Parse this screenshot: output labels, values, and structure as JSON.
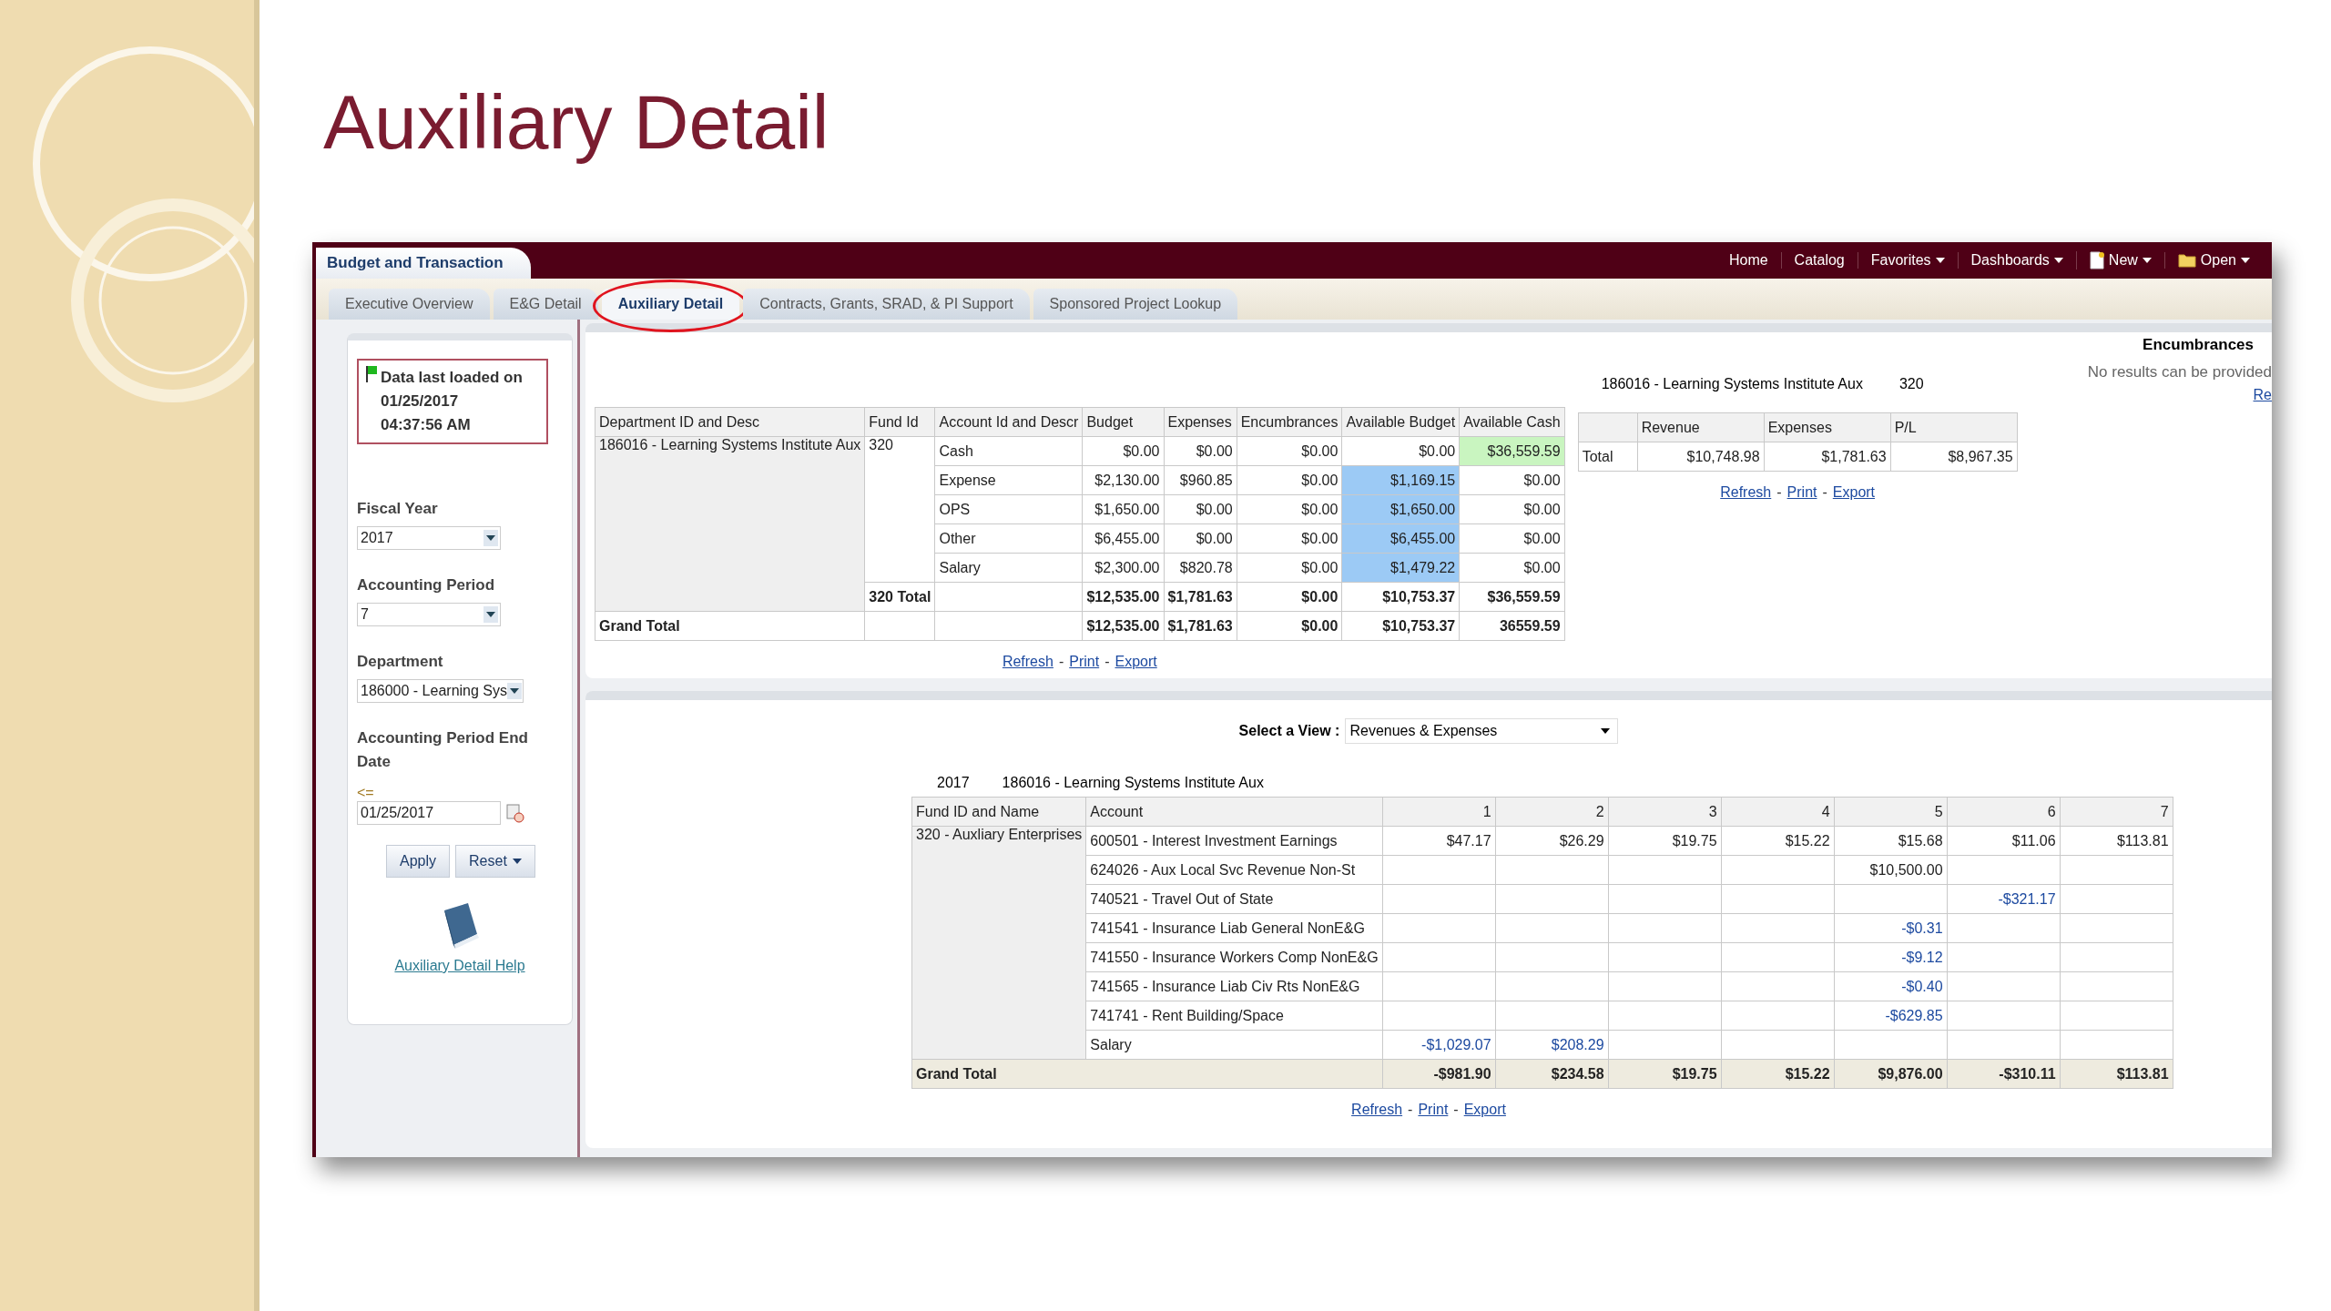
{
  "slide": {
    "title": "Auxiliary Detail"
  },
  "app": {
    "title": "Budget and Transaction",
    "nav": [
      {
        "label": "Home",
        "kind": "link"
      },
      {
        "label": "Catalog",
        "kind": "link"
      },
      {
        "label": "Favorites",
        "kind": "menu"
      },
      {
        "label": "Dashboards",
        "kind": "menu"
      },
      {
        "label": "New",
        "kind": "doc-menu"
      },
      {
        "label": "Open",
        "kind": "folder-menu"
      }
    ],
    "tabs": [
      {
        "label": "Executive Overview",
        "selected": false,
        "circled": false
      },
      {
        "label": "E&G Detail",
        "selected": false,
        "circled": false
      },
      {
        "label": "Auxiliary Detail",
        "selected": true,
        "circled": true
      },
      {
        "label": "Contracts, Grants, SRAD, & PI Support",
        "selected": false,
        "circled": false
      },
      {
        "label": "Sponsored Project Lookup",
        "selected": false,
        "circled": false
      }
    ],
    "sidebar": {
      "status": [
        "Data last loaded on",
        "01/25/2017",
        "04:37:56 AM"
      ],
      "filters": [
        {
          "label": "Fiscal Year",
          "value": "2017",
          "kind": "select"
        },
        {
          "label": "Accounting Period",
          "value": "7",
          "kind": "select"
        },
        {
          "label": "Department",
          "value": "186000 - Learning Sys",
          "kind": "select"
        },
        {
          "label": "Accounting Period End Date",
          "operator": "<=",
          "value": "01/25/2017",
          "kind": "date"
        }
      ],
      "buttons": [
        {
          "label": "Apply",
          "kind": "button"
        },
        {
          "label": "Reset",
          "kind": "menu"
        }
      ],
      "help_link": "Auxiliary Detail Help"
    },
    "summary": {
      "columns": [
        "Department ID and Desc",
        "Fund Id",
        "Account Id and Descr",
        "Budget",
        "Expenses",
        "Encumbrances",
        "Available Budget",
        "Available Cash"
      ],
      "department": "186016 - Learning Systems Institute Aux",
      "fund": "320",
      "rows": [
        {
          "account": "Cash",
          "values": [
            "$0.00",
            "$0.00",
            "$0.00",
            "$0.00",
            "$36,559.59"
          ],
          "kind": "cash"
        },
        {
          "account": "Expense",
          "values": [
            "$2,130.00",
            "$960.85",
            "$0.00",
            "$1,169.15",
            "$0.00"
          ],
          "kind": "budget"
        },
        {
          "account": "OPS",
          "values": [
            "$1,650.00",
            "$0.00",
            "$0.00",
            "$1,650.00",
            "$0.00"
          ],
          "kind": "budget"
        },
        {
          "account": "Other",
          "values": [
            "$6,455.00",
            "$0.00",
            "$0.00",
            "$6,455.00",
            "$0.00"
          ],
          "kind": "budget"
        },
        {
          "account": "Salary",
          "values": [
            "$2,300.00",
            "$820.78",
            "$0.00",
            "$1,479.22",
            "$0.00"
          ],
          "kind": "budget"
        }
      ],
      "subtotal": {
        "label": "320 Total",
        "values": [
          "$12,535.00",
          "$1,781.63",
          "$0.00",
          "$10,753.37",
          "$36,559.59"
        ]
      },
      "grand_total": {
        "label": "Grand Total",
        "values": [
          "$12,535.00",
          "$1,781.63",
          "$0.00",
          "$10,753.37",
          "36559.59"
        ]
      },
      "links": [
        "Refresh",
        "Print",
        "Export"
      ],
      "separator": "-"
    },
    "pl": {
      "department": "186016 - Learning Systems Institute Aux",
      "fund": "320",
      "columns": [
        "Revenue",
        "Expenses",
        "P/L"
      ],
      "row": {
        "label": "Total",
        "values": [
          "$10,748.98",
          "$1,781.63",
          "$8,967.35"
        ]
      },
      "links": [
        "Refresh",
        "Print",
        "Export"
      ],
      "separator": "-"
    },
    "encumbrances": {
      "title": "Encumbrances",
      "message": "No results can be provided",
      "link": "Re"
    },
    "detail": {
      "view_label": "Select a View :",
      "view": "Revenues & Expenses",
      "year": "2017",
      "department": "186016 - Learning Systems Institute Aux",
      "columns": [
        "Fund ID and Name",
        "Account",
        "1",
        "2",
        "3",
        "4",
        "5",
        "6",
        "7"
      ],
      "fund": "320 - Auxliary Enterprises",
      "rows": [
        {
          "account": "600501 - Interest Investment Earnings",
          "values": {
            "p1": "$47.17",
            "p2": "$26.29",
            "p3": "$19.75",
            "p4": "$15.22",
            "p5": "$15.68",
            "p6": "$11.06",
            "p7": "$113.81"
          },
          "link": false
        },
        {
          "account": "624026 - Aux Local Svc Revenue Non-St",
          "values": {
            "p5": "$10,500.00"
          },
          "link": false
        },
        {
          "account": "740521 - Travel Out of State",
          "values": {
            "p6": "-$321.17"
          },
          "link": true
        },
        {
          "account": "741541 - Insurance Liab General NonE&G",
          "values": {
            "p5": "-$0.31"
          },
          "link": true
        },
        {
          "account": "741550 - Insurance Workers Comp NonE&G",
          "values": {
            "p5": "-$9.12"
          },
          "link": true
        },
        {
          "account": "741565 - Insurance Liab Civ Rts NonE&G",
          "values": {
            "p5": "-$0.40"
          },
          "link": true
        },
        {
          "account": "741741 - Rent Building/Space",
          "values": {
            "p5": "-$629.85"
          },
          "link": true
        },
        {
          "account": "Salary",
          "values": {
            "p1": "-$1,029.07",
            "p2": "$208.29"
          },
          "link": true
        }
      ],
      "grand_total": {
        "label": "Grand Total",
        "values": [
          "-$981.90",
          "$234.58",
          "$19.75",
          "$15.22",
          "$9,876.00",
          "-$310.11",
          "$113.81"
        ]
      },
      "links": [
        "Refresh",
        "Print",
        "Export"
      ],
      "separator": "-"
    }
  }
}
